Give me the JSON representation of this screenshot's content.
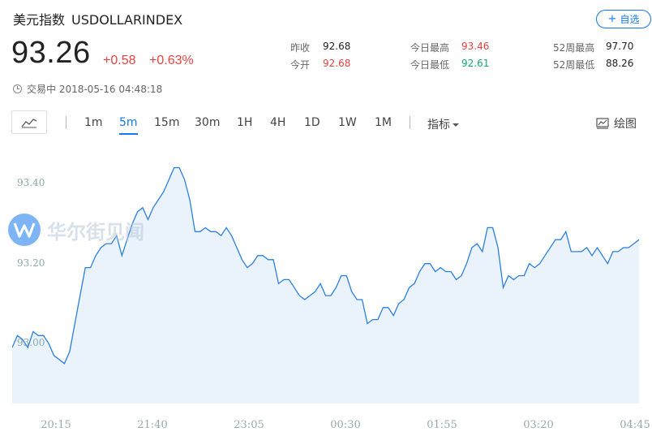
{
  "header": {
    "title": "美元指数",
    "code": "USDOLLARINDEX",
    "add_button": "自选"
  },
  "quote": {
    "price": "93.26",
    "change": "+0.58",
    "change_pct": "+0.63%",
    "status": "交易中 2018-05-16 04:48:18"
  },
  "stats": {
    "prev_close_label": "昨收",
    "prev_close": "92.68",
    "open_label": "今开",
    "open": "92.68",
    "day_high_label": "今日最高",
    "day_high": "93.46",
    "day_low_label": "今日最低",
    "day_low": "92.61",
    "w52_high_label": "52周最高",
    "w52_high": "97.70",
    "w52_low_label": "52周最低",
    "w52_low": "88.26"
  },
  "toolbar": {
    "timeframes": [
      "1m",
      "5m",
      "15m",
      "30m",
      "1H",
      "4H",
      "1D",
      "1W",
      "1M"
    ],
    "active_timeframe": "5m",
    "indicator_label": "指标",
    "draw_label": "绘图"
  },
  "watermark": {
    "text": "华尔街见闻"
  },
  "colors": {
    "accent": "#1478f0",
    "up": "#e8423f",
    "down": "#13a86a",
    "line": "#2b7fe0",
    "fill": "#e6f1fb"
  },
  "chart_data": {
    "type": "area",
    "ytick_labels": [
      "93.40",
      "93.20",
      "93.00"
    ],
    "yticks": [
      93.4,
      93.2,
      93.0
    ],
    "xtick_labels": [
      "20:15",
      "21:40",
      "23:05",
      "00:30",
      "01:55",
      "03:20",
      "04:45"
    ],
    "ylim": [
      92.85,
      93.5
    ],
    "grid": false,
    "series": [
      {
        "values": [
          92.99,
          93.02,
          93.01,
          92.99,
          93.03,
          93.02,
          93.02,
          93.0,
          92.97,
          92.96,
          92.95,
          92.98,
          93.05,
          93.12,
          93.19,
          93.19,
          93.22,
          93.24,
          93.25,
          93.25,
          93.27,
          93.22,
          93.26,
          93.3,
          93.33,
          93.34,
          93.31,
          93.34,
          93.36,
          93.38,
          93.41,
          93.44,
          93.44,
          93.41,
          93.36,
          93.28,
          93.28,
          93.29,
          93.28,
          93.28,
          93.27,
          93.29,
          93.27,
          93.24,
          93.21,
          93.19,
          93.2,
          93.22,
          93.22,
          93.21,
          93.21,
          93.15,
          93.16,
          93.16,
          93.14,
          93.12,
          93.11,
          93.12,
          93.13,
          93.15,
          93.12,
          93.12,
          93.14,
          93.17,
          93.17,
          93.13,
          93.11,
          93.11,
          93.05,
          93.06,
          93.06,
          93.09,
          93.09,
          93.07,
          93.1,
          93.11,
          93.14,
          93.15,
          93.18,
          93.2,
          93.2,
          93.18,
          93.19,
          93.18,
          93.18,
          93.16,
          93.17,
          93.2,
          93.24,
          93.25,
          93.23,
          93.29,
          93.29,
          93.24,
          93.14,
          93.17,
          93.16,
          93.17,
          93.17,
          93.2,
          93.19,
          93.2,
          93.22,
          93.24,
          93.26,
          93.26,
          93.28,
          93.23,
          93.23,
          93.23,
          93.24,
          93.22,
          93.24,
          93.22,
          93.2,
          93.23,
          93.23,
          93.24,
          93.24,
          93.25,
          93.26
        ]
      }
    ]
  }
}
